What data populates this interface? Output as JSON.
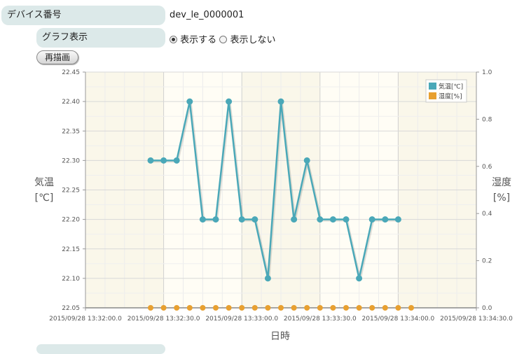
{
  "form": {
    "device_label": "デバイス番号",
    "device_value": "dev_le_0000001",
    "graph_label": "グラフ表示",
    "radio_show": "表示する",
    "radio_hide": "表示しない",
    "redraw_button": "再描画"
  },
  "colors": {
    "temp": "#4aa8b8",
    "humidity": "#e8a030",
    "plot_bg": "#fffdf5"
  },
  "chart_data": {
    "type": "line",
    "xlabel": "日時",
    "ylabel_left": [
      "気温",
      "[℃]"
    ],
    "ylabel_right": [
      "湿度",
      "[%]"
    ],
    "y_left_lim": [
      22.05,
      22.45
    ],
    "y_right_lim": [
      0.0,
      1.0
    ],
    "grid": true,
    "legend_position": "top-right",
    "x_ticks": [
      "2015/09/28 13:32:00.0",
      "2015/09/28 13:32:30.0",
      "2015/09/28 13:33:00.0",
      "2015/09/28 13:33:30.0",
      "2015/09/28 13:34:00.0",
      "2015/09/28 13:34:30.0"
    ],
    "y_left_ticks": [
      "22.45",
      "22.40",
      "22.35",
      "22.30",
      "22.25",
      "22.20",
      "22.15",
      "22.10",
      "22.05"
    ],
    "y_right_ticks": [
      "1.0",
      "0.8",
      "0.6",
      "0.4",
      "0.2",
      "0.0"
    ],
    "x_seconds": [
      25,
      30,
      35,
      40,
      45,
      50,
      55,
      60,
      65,
      70,
      75,
      80,
      85,
      90,
      95,
      100,
      105,
      110,
      115,
      120,
      125
    ],
    "series": [
      {
        "name": "気温[℃]",
        "axis": "left",
        "values": [
          22.3,
          22.3,
          22.3,
          22.4,
          22.2,
          22.2,
          22.4,
          22.2,
          22.2,
          22.1,
          22.4,
          22.2,
          22.3,
          22.2,
          22.2,
          22.2,
          22.1,
          22.2,
          22.2,
          22.2,
          null
        ]
      },
      {
        "name": "湿度[%]",
        "axis": "right",
        "values": [
          0,
          0,
          0,
          0,
          0,
          0,
          0,
          0,
          0,
          0,
          0,
          0,
          0,
          0,
          0,
          0,
          0,
          0,
          0,
          0,
          0
        ]
      }
    ]
  }
}
